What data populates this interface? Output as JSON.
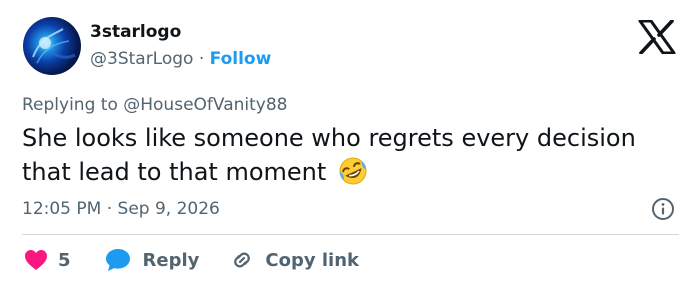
{
  "author": {
    "name": "3starlogo",
    "handle": "@3StarLogo",
    "separator": "·",
    "follow_label": "Follow"
  },
  "reply_context": {
    "prefix": "Replying to",
    "mention": "@HouseOfVanity88"
  },
  "tweet": {
    "text": "She looks like someone who regrets every decision that lead to that moment",
    "emoji": "rolling-on-floor-laughing"
  },
  "meta": {
    "timestamp": "12:05 PM · Sep 9, 2026"
  },
  "actions": {
    "like_count": "5",
    "reply_label": "Reply",
    "copy_label": "Copy link"
  },
  "icons": {
    "brand": "x-logo-icon",
    "info": "info-icon",
    "like": "heart-icon",
    "reply": "speech-bubble-icon",
    "copy": "link-icon"
  },
  "colors": {
    "accent": "#1d9bf0",
    "like": "#f91880",
    "secondary_text": "#536471",
    "primary_text": "#0f1419",
    "divider": "#cfd9de"
  }
}
